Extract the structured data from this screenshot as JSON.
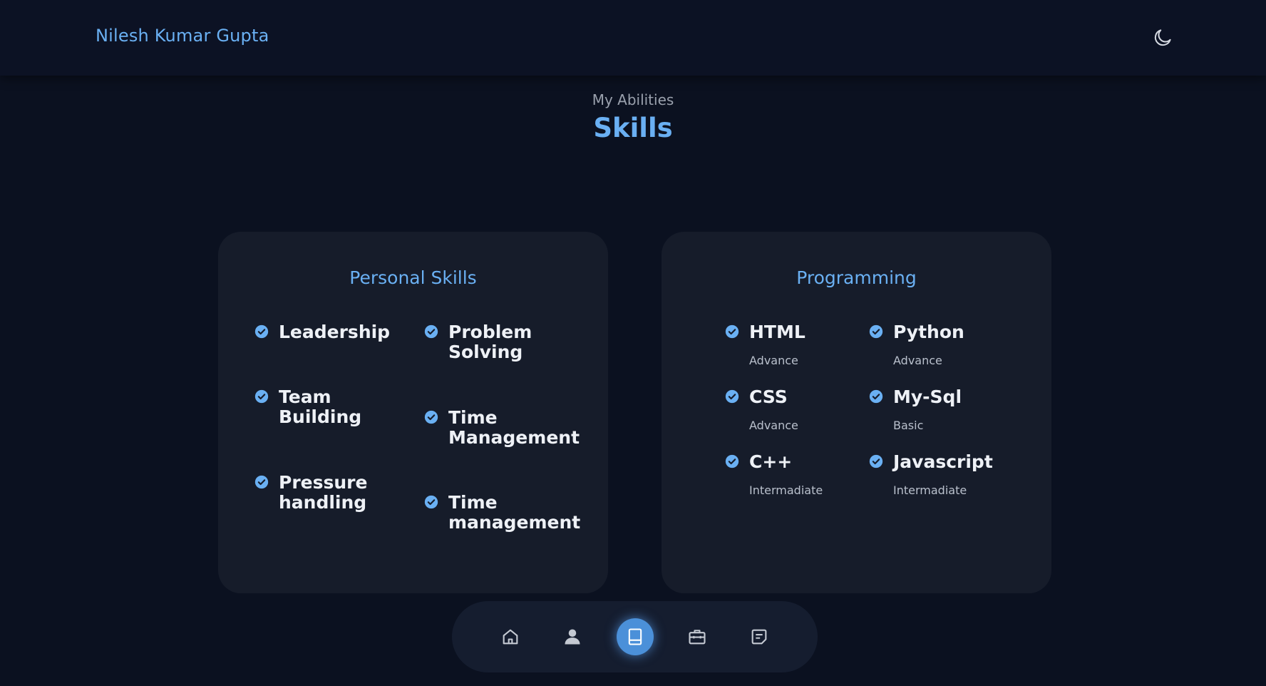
{
  "header": {
    "brand": "Nilesh Kumar Gupta",
    "theme_toggle_icon": "moon-icon"
  },
  "section": {
    "subtitle": "My Abilities",
    "title": "Skills"
  },
  "personal_skills": {
    "title": "Personal Skills",
    "items": [
      {
        "name": "Leadership"
      },
      {
        "name": "Problem Solving"
      },
      {
        "name": "Team Building"
      },
      {
        "name": "Time Management"
      },
      {
        "name": "Pressure handling"
      },
      {
        "name": "Time management"
      }
    ]
  },
  "programming": {
    "title": "Programming",
    "items": [
      {
        "name": "HTML",
        "level": "Advance"
      },
      {
        "name": "Python",
        "level": "Advance"
      },
      {
        "name": "CSS",
        "level": "Advance"
      },
      {
        "name": "My-Sql",
        "level": "Basic"
      },
      {
        "name": "C++",
        "level": "Intermadiate"
      },
      {
        "name": "Javascript",
        "level": "Intermadiate"
      }
    ]
  },
  "nav": {
    "items": [
      {
        "icon": "home-icon"
      },
      {
        "icon": "user-icon"
      },
      {
        "icon": "book-icon",
        "active": true
      },
      {
        "icon": "briefcase-icon"
      },
      {
        "icon": "message-icon"
      }
    ]
  },
  "colors": {
    "accent": "#6ab0f3",
    "background": "#0b1120",
    "card": "#161c2a",
    "nav_active": "#4b90d9"
  }
}
